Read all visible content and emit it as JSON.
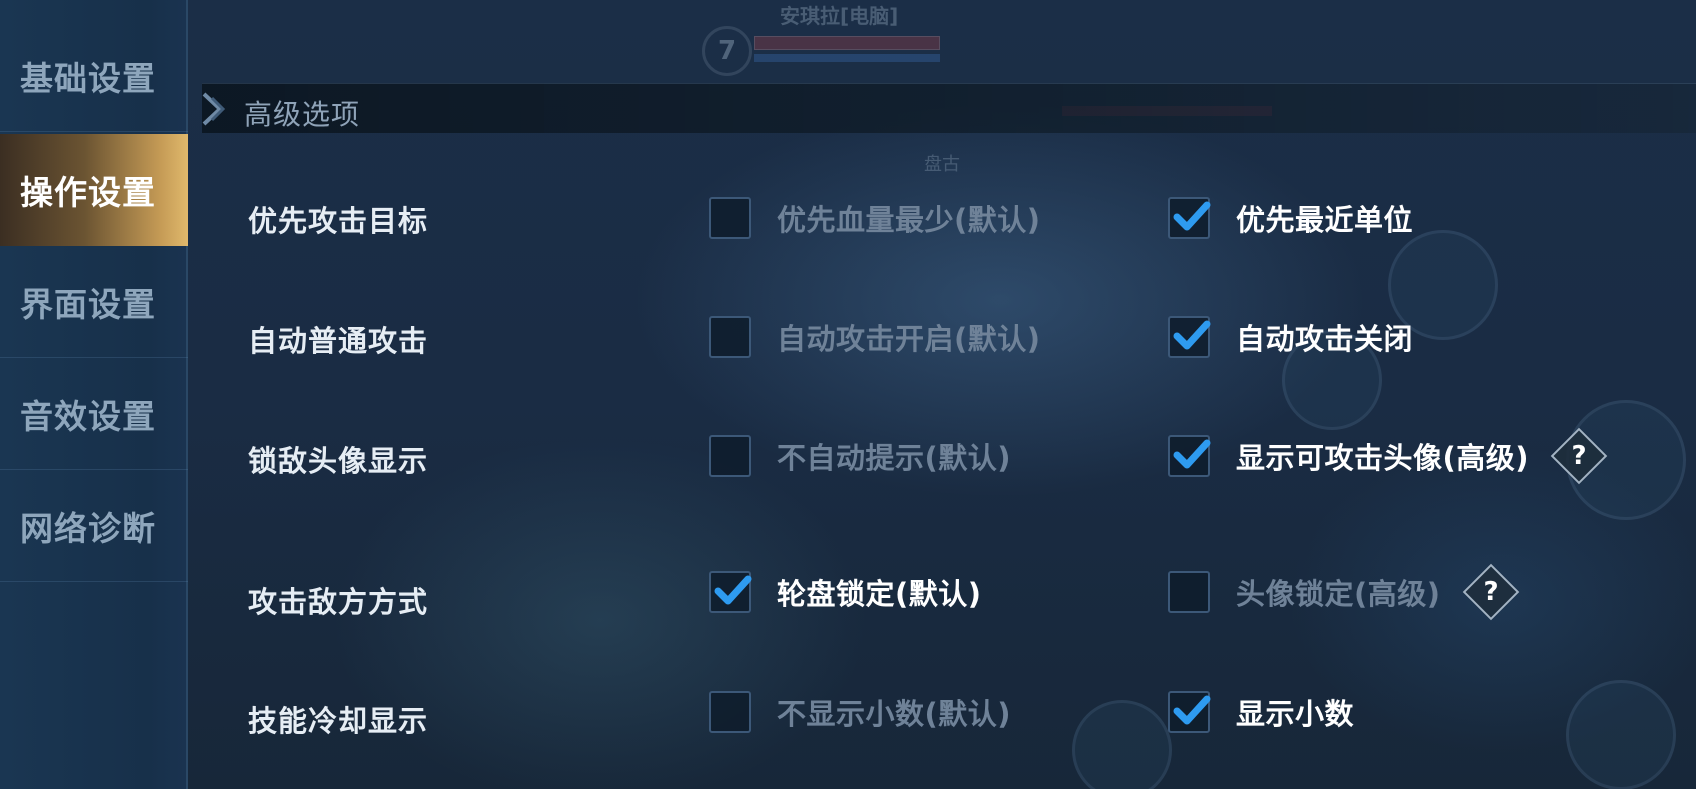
{
  "background": {
    "player_name": "安琪拉[电脑]",
    "player_level": "7",
    "enemy_name": "盘古"
  },
  "sidebar": {
    "items": [
      {
        "label": "基础设置",
        "active": false
      },
      {
        "label": "操作设置",
        "active": true
      },
      {
        "label": "界面设置",
        "active": false
      },
      {
        "label": "音效设置",
        "active": false
      },
      {
        "label": "网络诊断",
        "active": false
      }
    ]
  },
  "section": {
    "title": "高级选项"
  },
  "rows": [
    {
      "label": "优先攻击目标",
      "options": [
        {
          "label": "优先血量最少(默认)",
          "checked": false
        },
        {
          "label": "优先最近单位",
          "checked": true
        }
      ]
    },
    {
      "label": "自动普通攻击",
      "options": [
        {
          "label": "自动攻击开启(默认)",
          "checked": false
        },
        {
          "label": "自动攻击关闭",
          "checked": true
        }
      ]
    },
    {
      "label": "锁敌头像显示",
      "options": [
        {
          "label": "不自动提示(默认)",
          "checked": false
        },
        {
          "label": "显示可攻击头像(高级)",
          "checked": true,
          "help": "?"
        }
      ]
    },
    {
      "label": "攻击敌方方式",
      "options": [
        {
          "label": "轮盘锁定(默认)",
          "checked": true
        },
        {
          "label": "头像锁定(高级)",
          "checked": false,
          "help": "?"
        }
      ]
    },
    {
      "label": "技能冷却显示",
      "options": [
        {
          "label": "不显示小数(默认)",
          "checked": false
        },
        {
          "label": "显示小数",
          "checked": true
        }
      ]
    }
  ],
  "colors": {
    "check": "#2e9bf0",
    "active_tab": "#c49a55"
  }
}
